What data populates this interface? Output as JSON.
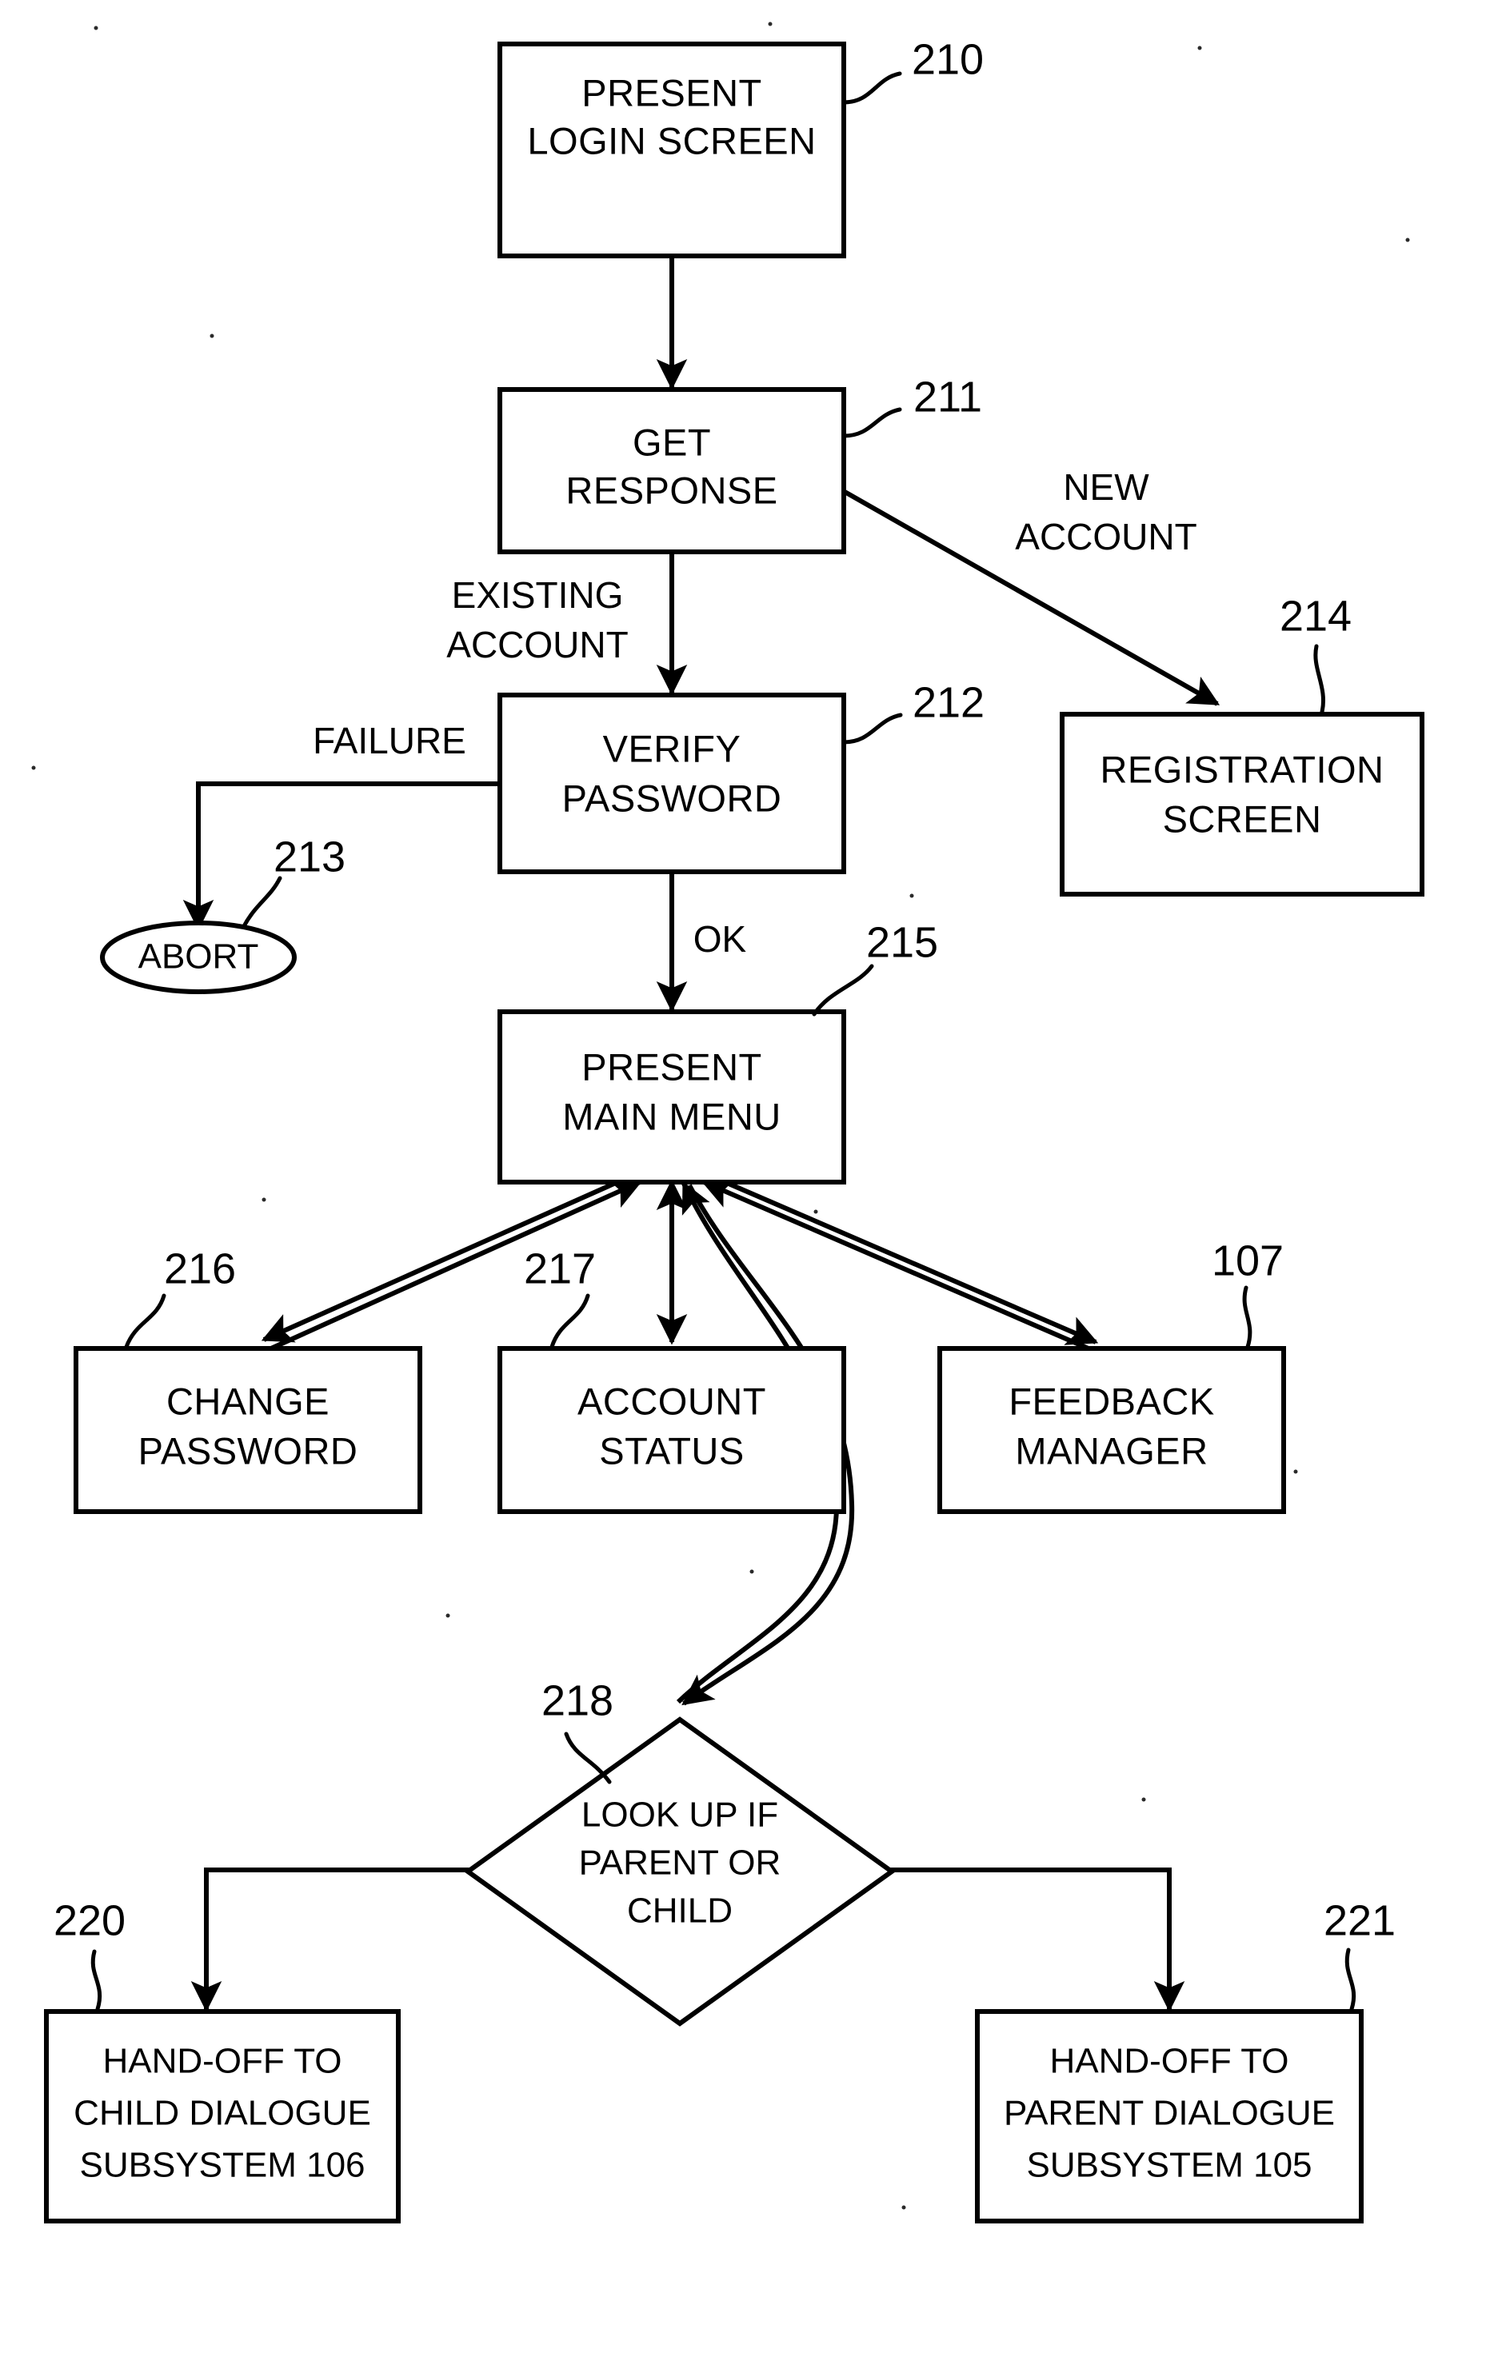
{
  "diagram": {
    "type": "patent-flowchart",
    "title": "Login and main menu process flow",
    "background_color": "#ffffff",
    "line_color": "#000000"
  },
  "nodes": {
    "present_login_screen": {
      "ref": "210",
      "shape": "rectangle",
      "line1": "PRESENT",
      "line2": "LOGIN SCREEN"
    },
    "get_response": {
      "ref": "211",
      "shape": "rectangle",
      "line1": "GET",
      "line2": "RESPONSE"
    },
    "verify_password": {
      "ref": "212",
      "shape": "rectangle",
      "line1": "VERIFY",
      "line2": "PASSWORD"
    },
    "abort": {
      "ref": "213",
      "shape": "oval",
      "line1": "ABORT"
    },
    "registration_screen": {
      "ref": "214",
      "shape": "rectangle",
      "line1": "REGISTRATION",
      "line2": "SCREEN"
    },
    "present_main_menu": {
      "ref": "215",
      "shape": "rectangle",
      "line1": "PRESENT",
      "line2": "MAIN MENU"
    },
    "change_password": {
      "ref": "216",
      "shape": "rectangle",
      "line1": "CHANGE",
      "line2": "PASSWORD"
    },
    "account_status": {
      "ref": "217",
      "shape": "rectangle",
      "line1": "ACCOUNT",
      "line2": "STATUS"
    },
    "feedback_manager": {
      "ref": "107",
      "shape": "rectangle",
      "line1": "FEEDBACK",
      "line2": "MANAGER"
    },
    "lookup_parent_or_child": {
      "ref": "218",
      "shape": "diamond",
      "line1": "LOOK UP IF",
      "line2": "PARENT OR",
      "line3": "CHILD"
    },
    "handoff_child": {
      "ref": "220",
      "shape": "rectangle",
      "line1": "HAND-OFF TO",
      "line2": "CHILD DIALOGUE",
      "line3": "SUBSYSTEM 106"
    },
    "handoff_parent": {
      "ref": "221",
      "shape": "rectangle",
      "line1": "HAND-OFF TO",
      "line2": "PARENT DIALOGUE",
      "line3": "SUBSYSTEM 105"
    }
  },
  "edge_labels": {
    "new_account_line1": "NEW",
    "new_account_line2": "ACCOUNT",
    "existing_account_line1": "EXISTING",
    "existing_account_line2": "ACCOUNT",
    "failure": "FAILURE",
    "ok": "OK"
  },
  "chart_data": {
    "type": "flowchart",
    "title": "Login and main menu process flow",
    "nodes": [
      {
        "ref": "210",
        "label": "PRESENT LOGIN SCREEN",
        "shape": "rectangle"
      },
      {
        "ref": "211",
        "label": "GET RESPONSE",
        "shape": "rectangle"
      },
      {
        "ref": "212",
        "label": "VERIFY PASSWORD",
        "shape": "rectangle"
      },
      {
        "ref": "213",
        "label": "ABORT",
        "shape": "oval"
      },
      {
        "ref": "214",
        "label": "REGISTRATION SCREEN",
        "shape": "rectangle"
      },
      {
        "ref": "215",
        "label": "PRESENT MAIN MENU",
        "shape": "rectangle"
      },
      {
        "ref": "216",
        "label": "CHANGE PASSWORD",
        "shape": "rectangle"
      },
      {
        "ref": "217",
        "label": "ACCOUNT STATUS",
        "shape": "rectangle"
      },
      {
        "ref": "107",
        "label": "FEEDBACK MANAGER",
        "shape": "rectangle"
      },
      {
        "ref": "218",
        "label": "LOOK UP IF PARENT OR CHILD",
        "shape": "diamond"
      },
      {
        "ref": "220",
        "label": "HAND-OFF TO CHILD DIALOGUE SUBSYSTEM 106",
        "shape": "rectangle"
      },
      {
        "ref": "221",
        "label": "HAND-OFF TO PARENT DIALOGUE SUBSYSTEM 105",
        "shape": "rectangle"
      }
    ],
    "edges": [
      {
        "from": "210",
        "to": "211",
        "label": ""
      },
      {
        "from": "211",
        "to": "214",
        "label": "NEW ACCOUNT"
      },
      {
        "from": "211",
        "to": "212",
        "label": "EXISTING ACCOUNT"
      },
      {
        "from": "212",
        "to": "213",
        "label": "FAILURE"
      },
      {
        "from": "212",
        "to": "215",
        "label": "OK"
      },
      {
        "from": "215",
        "to": "216",
        "label": ""
      },
      {
        "from": "216",
        "to": "215",
        "label": ""
      },
      {
        "from": "215",
        "to": "217",
        "label": ""
      },
      {
        "from": "217",
        "to": "215",
        "label": ""
      },
      {
        "from": "215",
        "to": "107",
        "label": ""
      },
      {
        "from": "215",
        "to": "218",
        "label": ""
      },
      {
        "from": "218",
        "to": "215",
        "label": ""
      },
      {
        "from": "218",
        "to": "220",
        "label": ""
      },
      {
        "from": "218",
        "to": "221",
        "label": ""
      }
    ]
  }
}
